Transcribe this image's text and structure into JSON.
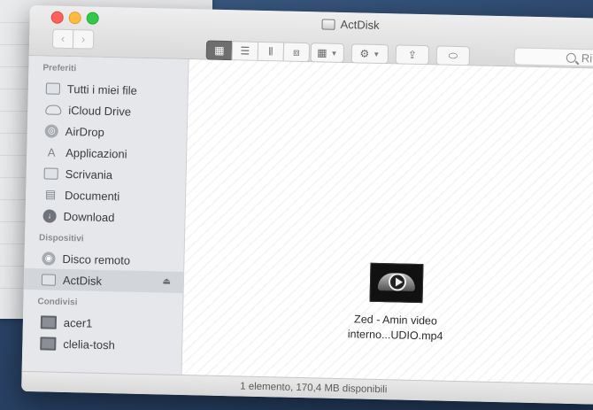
{
  "window": {
    "title": "ActDisk"
  },
  "toolbar": {
    "back_label": "‹",
    "forward_label": "›",
    "view_icons": [
      "▦",
      "☰",
      "⫴",
      "⧈"
    ],
    "arrange_icon": "▦",
    "action_icon": "⚙",
    "share_icon": "⇪",
    "tag_icon": "⬭",
    "search_placeholder": "Ri"
  },
  "sidebar": {
    "preferiti_title": "Preferiti",
    "preferiti": [
      {
        "label": "Tutti i miei file",
        "icon": "all-files-icon"
      },
      {
        "label": "iCloud Drive",
        "icon": "cloud-icon"
      },
      {
        "label": "AirDrop",
        "icon": "airdrop-icon"
      },
      {
        "label": "Applicazioni",
        "icon": "applications-icon"
      },
      {
        "label": "Scrivania",
        "icon": "desktop-folder-icon"
      },
      {
        "label": "Documenti",
        "icon": "documents-icon"
      },
      {
        "label": "Download",
        "icon": "download-icon"
      }
    ],
    "dispositivi_title": "Dispositivi",
    "dispositivi": [
      {
        "label": "Disco remoto",
        "icon": "remote-disc-icon"
      },
      {
        "label": "ActDisk",
        "icon": "disk-icon",
        "selected": true
      }
    ],
    "condivisi_title": "Condivisi",
    "condivisi": [
      {
        "label": "acer1",
        "icon": "computer-icon"
      },
      {
        "label": "clelia-tosh",
        "icon": "computer-icon"
      }
    ]
  },
  "content": {
    "file": {
      "line1": "Zed - Amin video",
      "line2": "interno...UDIO.mp4"
    }
  },
  "status": {
    "text": "1 elemento, 170,4 MB disponibili"
  },
  "colors": {
    "close": "#fc615d",
    "minimize": "#fdbc40",
    "maximize": "#34c84a"
  }
}
